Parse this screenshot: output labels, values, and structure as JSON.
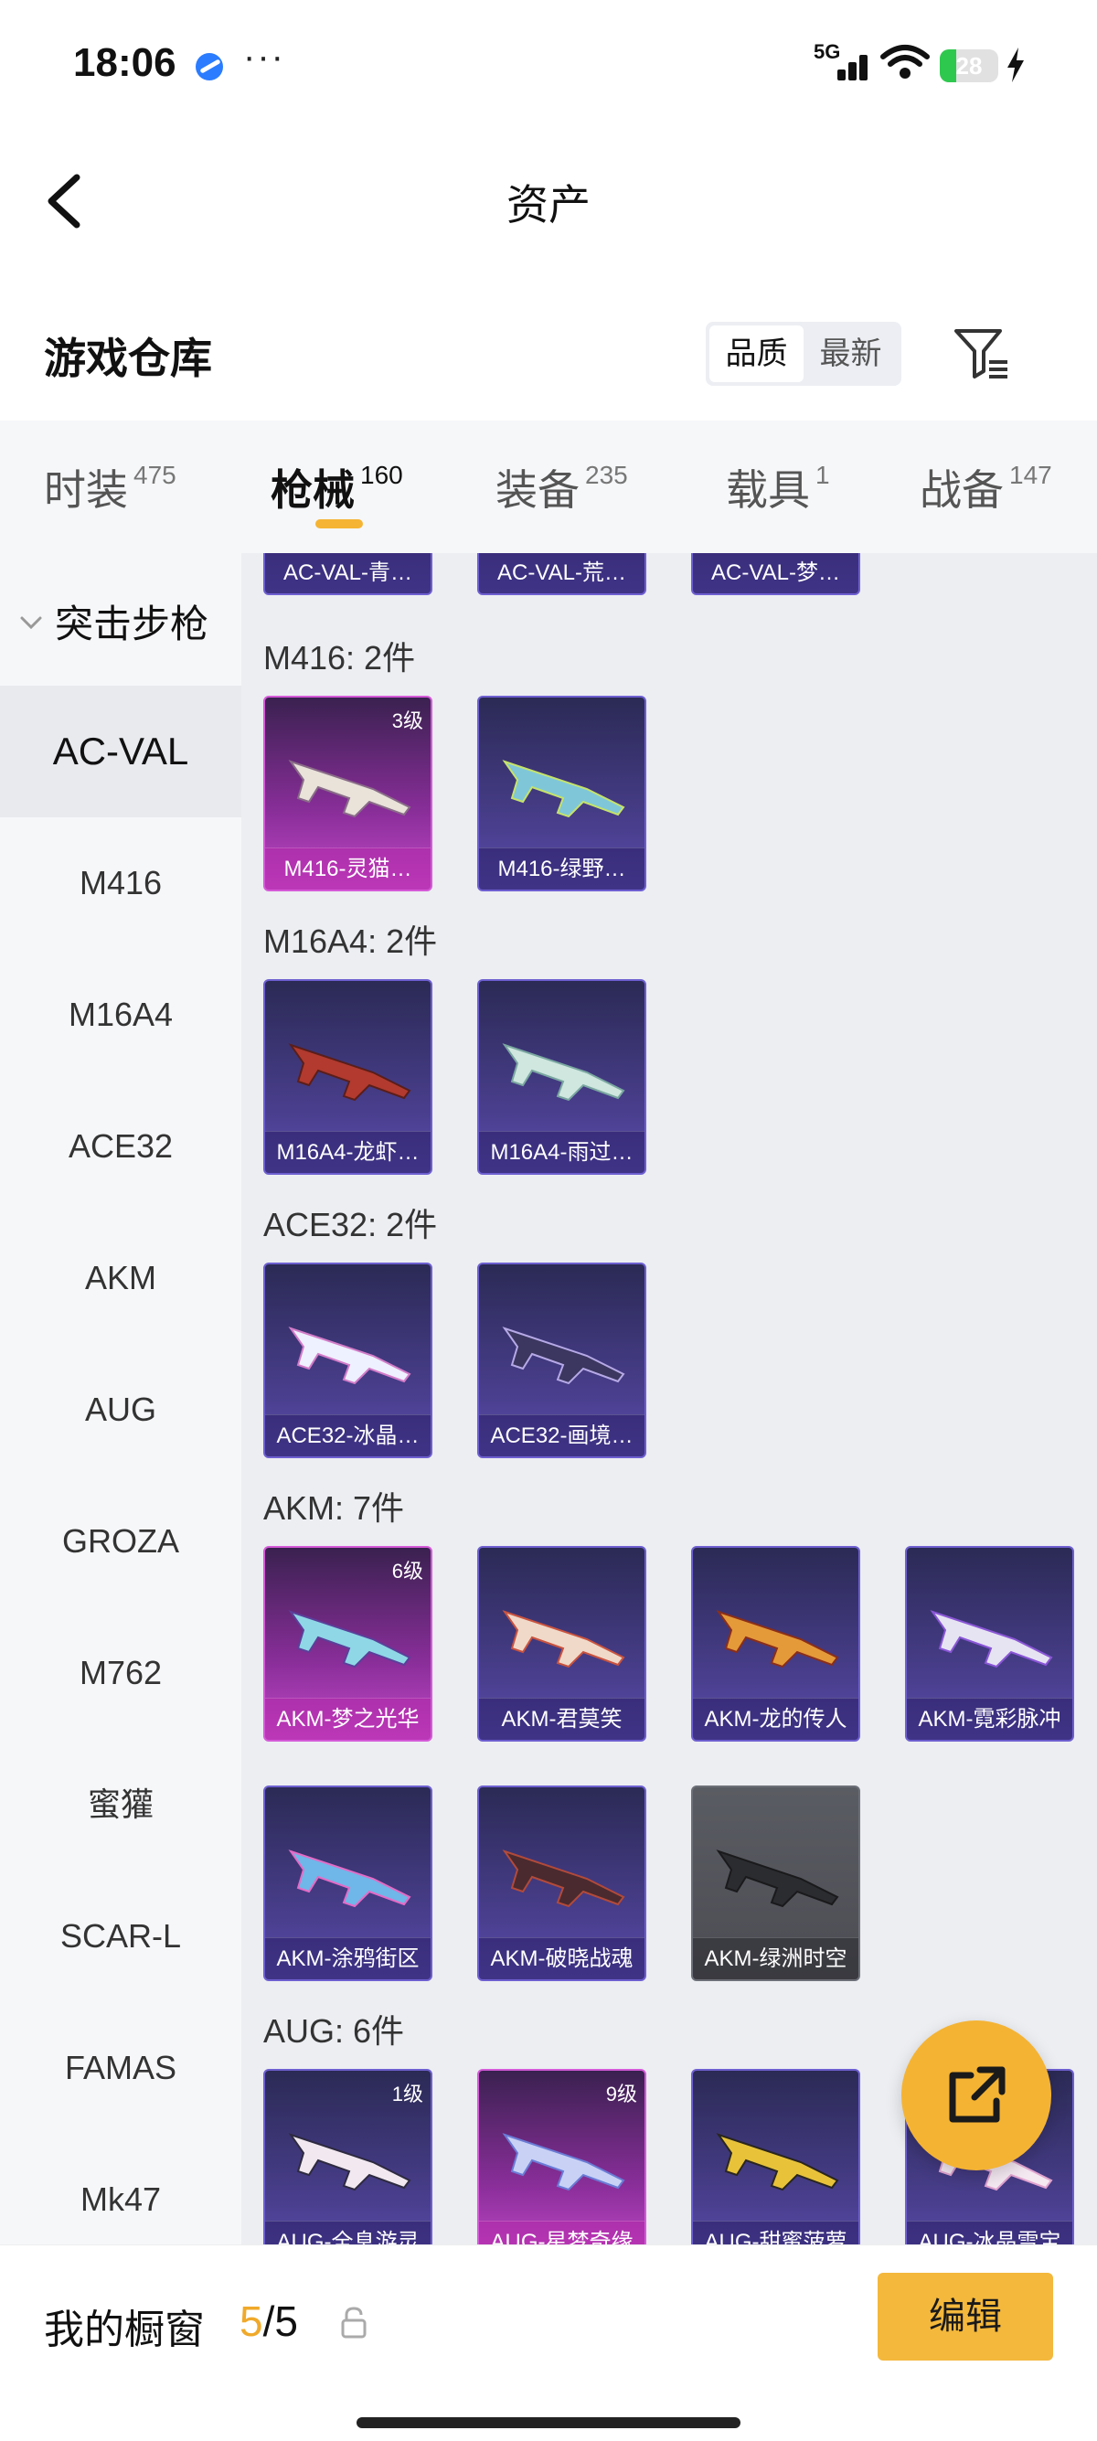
{
  "status_bar": {
    "time": "18:06",
    "more": "···",
    "network": "5G",
    "battery": "28"
  },
  "header": {
    "title": "资产"
  },
  "warehouse": {
    "title": "游戏仓库",
    "sort_options": [
      "品质",
      "最新"
    ],
    "active_sort": "品质"
  },
  "tabs": [
    {
      "label": "时装",
      "count": "475"
    },
    {
      "label": "枪械",
      "count": "160",
      "active": true
    },
    {
      "label": "装备",
      "count": "235"
    },
    {
      "label": "载具",
      "count": "1"
    },
    {
      "label": "战备",
      "count": "147"
    }
  ],
  "sidebar": {
    "group": "突击步枪",
    "items": [
      "AC-VAL",
      "M416",
      "M16A4",
      "ACE32",
      "AKM",
      "AUG",
      "GROZA",
      "M762",
      "蜜獾",
      "SCAR-L",
      "FAMAS",
      "Mk47"
    ],
    "active": "AC-VAL"
  },
  "sections": [
    {
      "title": "",
      "items": [
        {
          "name": "AC-VAL-青…",
          "level": ""
        },
        {
          "name": "AC-VAL-荒…",
          "level": ""
        },
        {
          "name": "AC-VAL-梦…",
          "level": ""
        }
      ]
    },
    {
      "title": "M416: 2件",
      "items": [
        {
          "name": "M416-灵猫…",
          "level": "3级",
          "rarity": "pink"
        },
        {
          "name": "M416-绿野…",
          "level": ""
        }
      ]
    },
    {
      "title": "M16A4: 2件",
      "items": [
        {
          "name": "M16A4-龙虾…",
          "level": ""
        },
        {
          "name": "M16A4-雨过…",
          "level": ""
        }
      ]
    },
    {
      "title": "ACE32: 2件",
      "items": [
        {
          "name": "ACE32-冰晶…",
          "level": ""
        },
        {
          "name": "ACE32-画境…",
          "level": ""
        }
      ]
    },
    {
      "title": "AKM: 7件",
      "items": [
        {
          "name": "AKM-梦之光华",
          "level": "6级",
          "rarity": "pink"
        },
        {
          "name": "AKM-君莫笑",
          "level": ""
        },
        {
          "name": "AKM-龙的传人",
          "level": ""
        },
        {
          "name": "AKM-霓彩脉冲",
          "level": ""
        },
        {
          "name": "AKM-涂鸦街区",
          "level": ""
        },
        {
          "name": "AKM-破晓战魂",
          "level": ""
        },
        {
          "name": "AKM-绿洲时空",
          "level": "",
          "rarity": "gray"
        }
      ]
    },
    {
      "title": "AUG: 6件",
      "items": [
        {
          "name": "AUG-全息游灵",
          "level": "1级"
        },
        {
          "name": "AUG-星梦奇缘",
          "level": "9级",
          "rarity": "pink"
        },
        {
          "name": "AUG-甜蜜菠萝",
          "level": ""
        },
        {
          "name": "AUG-冰晶雪宝",
          "level": ""
        }
      ]
    }
  ],
  "showcase": {
    "title": "我的橱窗",
    "current": "5",
    "total": "/5",
    "edit_label": "编辑"
  },
  "colors": {
    "accent": "#f4b83c",
    "epic": "#5c4fb0",
    "legendary": "#c44ac8",
    "common": "#5a5c63"
  }
}
